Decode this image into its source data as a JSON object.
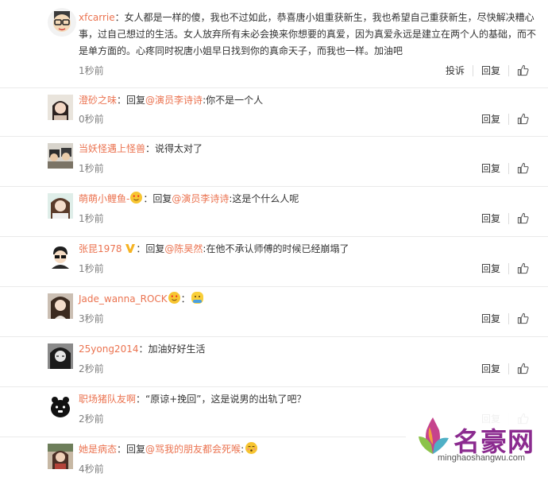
{
  "comments": [
    {
      "user": "xfcarrie",
      "sep": "：",
      "text": "女人都是一样的傻，我也不过如此，恭喜唐小姐重获新生，我也希望自己重获新生，尽快解决糟心事，过自己想过的生活。女人放弃所有未必会换来你想要的真爱，因为真爱永远是建立在两个人的基础，而不是单方面的。心疼同时祝唐小姐早日找到你的真命天子，而我也一样。加油吧",
      "time": "1秒前",
      "report": "投诉",
      "reply": "回复"
    },
    {
      "user": "澄砂之味",
      "sep": "：",
      "reply_prefix": "回复",
      "mention": "@演员李诗诗",
      "text": ":你不是一个人",
      "time": "0秒前",
      "reply": "回复"
    },
    {
      "user": "当妖怪遇上怪兽",
      "sep": "：",
      "text": "说得太对了",
      "time": "1秒前",
      "reply": "回复"
    },
    {
      "user": "萌萌小鲤鱼-",
      "sep": "：",
      "reply_prefix": "回复",
      "mention": "@演员李诗诗",
      "text": ":这是个什么人呢",
      "time": "1秒前",
      "reply": "回复"
    },
    {
      "user": "张昆1978",
      "sep": "：",
      "reply_prefix": "回复",
      "mention": "@陈昊然",
      "text": ":在他不承认师傅的时候已经崩塌了",
      "time": "1秒前",
      "reply": "回复"
    },
    {
      "user": "Jade_wanna_ROCK",
      "sep": "：",
      "time": "3秒前",
      "reply": "回复"
    },
    {
      "user": "25yong2014",
      "sep": "：",
      "text": "加油好好生活",
      "time": "2秒前",
      "reply": "回复"
    },
    {
      "user": "职场猪队友啊",
      "sep": "：",
      "text": "“原谅+挽回”，这是说男的出轨了吧？",
      "time": "2秒前",
      "reply": "回复"
    },
    {
      "user": "她是病态",
      "sep": "：",
      "reply_prefix": "回复",
      "mention": "@骂我的朋友都会死喉",
      "text": ":",
      "time": "4秒前",
      "reply": "回复"
    }
  ],
  "watermark": {
    "title": "名豪网",
    "url": "minghaoshangwu.com"
  },
  "colors": {
    "username": "#eb7350",
    "time": "#808080",
    "divider": "#eaeaea",
    "watermark_title": "#8b2b8f"
  },
  "icons": [
    "like-thumb-icon",
    "vip-badge-icon",
    "emoji-face-icon"
  ]
}
